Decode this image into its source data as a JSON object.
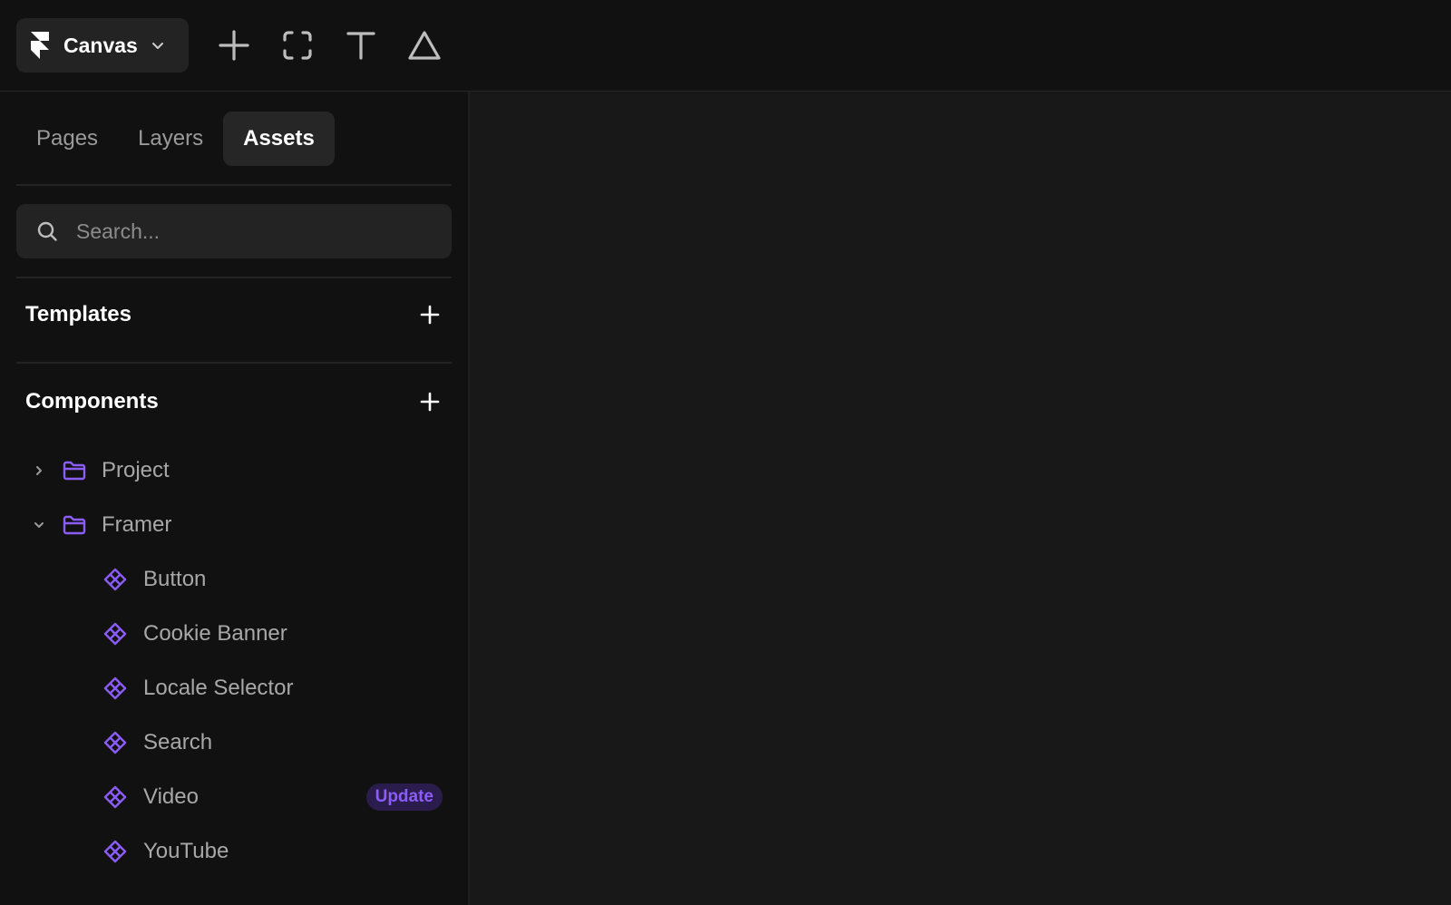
{
  "app": {
    "name": "Canvas",
    "logo_icon": "framer-logo-icon",
    "menu_icon": "chevron-down-icon"
  },
  "toolbar": {
    "tools": [
      {
        "icon": "plus-icon",
        "name": "insert"
      },
      {
        "icon": "frame-icon",
        "name": "frame"
      },
      {
        "icon": "text-icon",
        "name": "text"
      },
      {
        "icon": "triangle-icon",
        "name": "vector"
      }
    ]
  },
  "sidebar": {
    "tabs": [
      {
        "label": "Pages"
      },
      {
        "label": "Layers"
      },
      {
        "label": "Assets"
      }
    ],
    "active_tab": "Assets",
    "search": {
      "placeholder": "Search...",
      "value": ""
    },
    "templates": {
      "title": "Templates"
    },
    "components": {
      "title": "Components",
      "folders": [
        {
          "label": "Project",
          "expanded": false
        },
        {
          "label": "Framer",
          "expanded": true
        }
      ],
      "items": [
        {
          "label": "Button"
        },
        {
          "label": "Cookie Banner"
        },
        {
          "label": "Locale Selector"
        },
        {
          "label": "Search"
        },
        {
          "label": "Video",
          "badge": "Update"
        },
        {
          "label": "YouTube"
        }
      ]
    }
  },
  "colors": {
    "accent": "#8b5cf6",
    "background": "#181818",
    "panel": "#111111",
    "control": "#232323"
  }
}
